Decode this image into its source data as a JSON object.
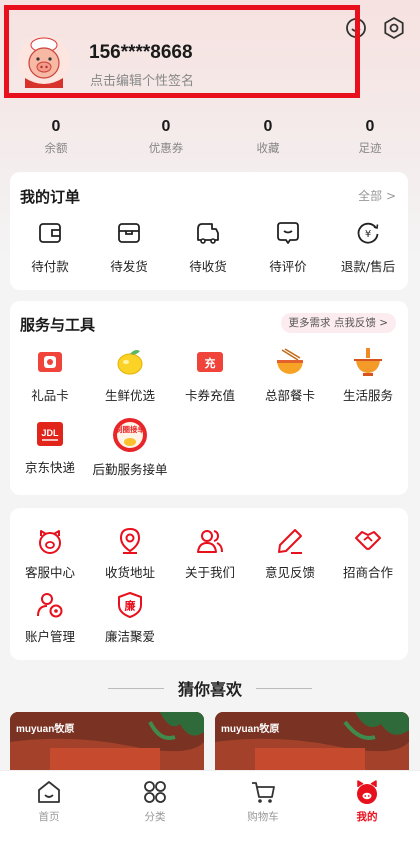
{
  "profile": {
    "phone": "156****8668",
    "signature": "点击编辑个性签名"
  },
  "header_icons": [
    "support-icon",
    "settings-icon"
  ],
  "stats": [
    {
      "value": "0",
      "label": "余额"
    },
    {
      "value": "0",
      "label": "优惠券"
    },
    {
      "value": "0",
      "label": "收藏"
    },
    {
      "value": "0",
      "label": "足迹"
    }
  ],
  "orders": {
    "title": "我的订单",
    "all_label": "全部 >",
    "items": [
      {
        "label": "待付款",
        "icon": "wallet-icon"
      },
      {
        "label": "待发货",
        "icon": "box-icon"
      },
      {
        "label": "待收货",
        "icon": "truck-icon"
      },
      {
        "label": "待评价",
        "icon": "comment-icon"
      },
      {
        "label": "退款/售后",
        "icon": "refund-icon"
      }
    ]
  },
  "services": {
    "title": "服务与工具",
    "feedback_label": "更多需求 点我反馈 >",
    "items": [
      {
        "label": "礼品卡",
        "icon": "gift-card-icon"
      },
      {
        "label": "生鲜优选",
        "icon": "lemon-icon"
      },
      {
        "label": "卡券充值",
        "icon": "recharge-icon",
        "badge": "充"
      },
      {
        "label": "总部餐卡",
        "icon": "noodle-bowl-icon"
      },
      {
        "label": "生活服务",
        "icon": "hotpot-icon"
      },
      {
        "label": "京东快递",
        "icon": "jd-logistics-icon",
        "badge": "JDL"
      },
      {
        "label": "后勤服务接单",
        "icon": "order-taking-icon",
        "badge": "刷圈接单"
      }
    ]
  },
  "tools": {
    "items": [
      {
        "label": "客服中心",
        "icon": "customer-service-icon"
      },
      {
        "label": "收货地址",
        "icon": "location-icon"
      },
      {
        "label": "关于我们",
        "icon": "people-icon"
      },
      {
        "label": "意见反馈",
        "icon": "pencil-icon"
      },
      {
        "label": "招商合作",
        "icon": "handshake-icon"
      },
      {
        "label": "账户管理",
        "icon": "account-settings-icon"
      },
      {
        "label": "廉洁聚爱",
        "icon": "integrity-icon",
        "badge": "廉"
      }
    ]
  },
  "guess": {
    "title": "猜你喜欢"
  },
  "products": [
    {
      "brand": "muyuan牧原"
    },
    {
      "brand": "muyuan牧原"
    }
  ],
  "tabs": [
    {
      "label": "首页",
      "icon": "home-icon",
      "active": false
    },
    {
      "label": "分类",
      "icon": "category-icon",
      "active": false
    },
    {
      "label": "购物车",
      "icon": "cart-icon",
      "active": false
    },
    {
      "label": "我的",
      "icon": "mine-icon",
      "active": true
    }
  ],
  "colors": {
    "accent": "#e8101d",
    "highlight_box": "#e8101d"
  }
}
